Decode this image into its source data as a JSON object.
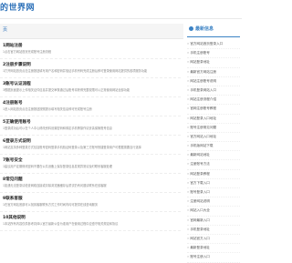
{
  "site": {
    "name": "的世界网"
  },
  "breadcrumb": {
    "current": "页"
  },
  "articles": [
    {
      "title": "1网站注册",
      "summary": "1点击官方网站首页完成账号注册流程"
    },
    {
      "title": "2注册步骤说明",
      "summary": "1打开网站首页点击注册按钮填写用户名和密码并验证手机号码完成注册后即可登录使用网站提供的各项服务功能"
    },
    {
      "title": "3账号认证流程",
      "summary": "3根据页面提示上传相关证件信息并提交审核通过后账号将获得完整权限可以正常使用网站全部功能"
    },
    {
      "title": "4注册账号",
      "summary": "1进入网站首页点击注册按钮按照提示填写相关信息即可完成账号注册"
    },
    {
      "title": "5正确使用账号",
      "summary": "1登录成功后可以在个人中心修改资料设置密码和绑定手机等操作请妥善保管账号信息"
    },
    {
      "title": "6登录方式说明",
      "summary": "1网站支持多种登录方式包括账号密码登录手机验证码登录以及第三方账号快捷登录用户可根据需要自行选择"
    },
    {
      "title": "7账号安全",
      "summary": "1建议用户定期修改密码不要在公共设备上保存登录信息发现异常请及时联系客服处理"
    },
    {
      "title": "8常见问题",
      "summary": "1如遇无法登录请检查网络连接或清除浏览器缓存后重试仍有问题请联系在线客服"
    },
    {
      "title": "9联系客服",
      "summary": "1在官方网站底部可以找到客服联系方式工作时间内均可提供在线咨询服务"
    },
    {
      "title": "10其他说明",
      "summary": "1本站所有内容仅供参考具体以官方最新公告为准用户在使用过程中应遵守相关规定和协议"
    }
  ],
  "sidebar": {
    "title": "最新信息",
    "items": [
      "官方网站首页登录入口",
      "手机注册账号",
      "网站登录地址",
      "最新官方网站注册",
      "网站注册账号说明",
      "手机登录网站入口",
      "网站注册流程介绍",
      "官网注册账号教程",
      "网站登录入口地址",
      "账号注册常见问题",
      "官方网站入口地址",
      "手机版网站下载",
      "最新网站地址",
      "注册账号方法",
      "网站登录教程",
      "官方下载入口",
      "账号登录入口",
      "注册网站说明",
      "网站入口大全",
      "官网最新入口",
      "手机登录地址",
      "网站官方入口",
      "最新登录地址",
      "账号注册入口"
    ]
  }
}
